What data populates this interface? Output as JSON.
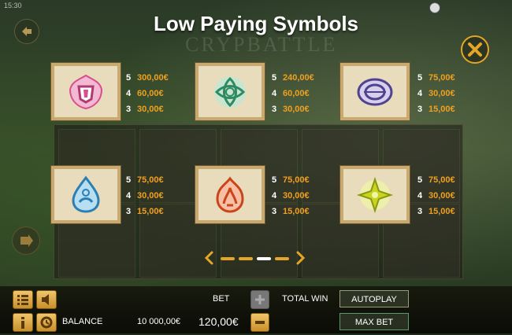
{
  "status": {
    "time": "15:30"
  },
  "title": "Low Paying Symbols",
  "symbols": [
    {
      "name": "pink-crest",
      "color": "#d64f8f",
      "payouts": [
        {
          "count": "5",
          "value": "300,00€"
        },
        {
          "count": "4",
          "value": "60,00€"
        },
        {
          "count": "3",
          "value": "30,00€"
        }
      ]
    },
    {
      "name": "green-knot",
      "color": "#3aaa7a",
      "payouts": [
        {
          "count": "5",
          "value": "240,00€"
        },
        {
          "count": "4",
          "value": "60,00€"
        },
        {
          "count": "3",
          "value": "30,00€"
        }
      ]
    },
    {
      "name": "purple-knot",
      "color": "#6a5aa8",
      "payouts": [
        {
          "count": "5",
          "value": "75,00€"
        },
        {
          "count": "4",
          "value": "30,00€"
        },
        {
          "count": "3",
          "value": "15,00€"
        }
      ]
    },
    {
      "name": "blue-drop",
      "color": "#3b92c6",
      "payouts": [
        {
          "count": "5",
          "value": "75,00€"
        },
        {
          "count": "4",
          "value": "30,00€"
        },
        {
          "count": "3",
          "value": "15,00€"
        }
      ]
    },
    {
      "name": "orange-flame",
      "color": "#d9592b",
      "payouts": [
        {
          "count": "5",
          "value": "75,00€"
        },
        {
          "count": "4",
          "value": "30,00€"
        },
        {
          "count": "3",
          "value": "15,00€"
        }
      ]
    },
    {
      "name": "yellow-star",
      "color": "#b8c818",
      "payouts": [
        {
          "count": "5",
          "value": "75,00€"
        },
        {
          "count": "4",
          "value": "30,00€"
        },
        {
          "count": "3",
          "value": "15,00€"
        }
      ]
    }
  ],
  "pagination": {
    "pages": 4,
    "current": 3
  },
  "bottom": {
    "bet_label": "BET",
    "bet_value": "120,00€",
    "total_win_label": "TOTAL WIN",
    "balance_label": "BALANCE",
    "balance_value": "10 000,00€",
    "autoplay_label": "AUTOPLAY",
    "max_bet_label": "MAX BET"
  },
  "colors": {
    "accent": "#e3a626",
    "payout": "#f0a020"
  }
}
